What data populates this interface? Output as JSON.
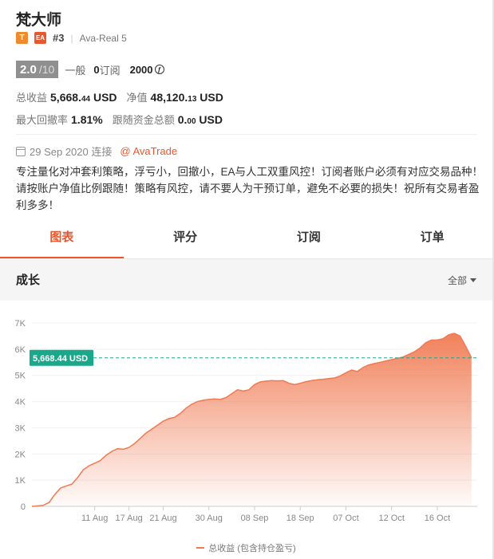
{
  "header": {
    "title": "梵大师",
    "badge_t": "T",
    "badge_ea": "EA",
    "rank": "#3",
    "account": "Ava-Real 5",
    "score": "2.0",
    "score_of": "/10",
    "level": "一般",
    "subs_count": "0",
    "subs_label": "订阅",
    "points": "2000"
  },
  "stats": {
    "total_profit_label": "总收益",
    "total_profit_main": "5,668.",
    "total_profit_dec": "44",
    "total_profit_unit": " USD",
    "equity_label": "净值",
    "equity_main": "48,120.",
    "equity_dec": "13",
    "equity_unit": " USD",
    "max_dd_label": "最大回撤率",
    "max_dd_value": "1.81%",
    "follow_label": "跟随资金总额",
    "follow_main": "0.",
    "follow_dec": "00",
    "follow_unit": " USD"
  },
  "meta": {
    "connected": "29 Sep 2020 连接",
    "broker": "@ AvaTrade"
  },
  "description": "专注量化对冲套利策略，浮亏小，回撤小，EA与人工双重风控！订阅者账户必须有对应交易品种！请按账户净值比例跟随！策略有风控，请不要人为干预订单，避免不必要的损失！祝所有交易者盈利多多！",
  "tabs": [
    {
      "label": "图表",
      "active": true
    },
    {
      "label": "评分",
      "active": false
    },
    {
      "label": "订阅",
      "active": false
    },
    {
      "label": "订单",
      "active": false
    }
  ],
  "panel": {
    "title": "成长",
    "filter": "全部"
  },
  "colors": {
    "accent": "#e8572e",
    "line": "#f07a52",
    "marker": "#1aa88a"
  },
  "chart_data": {
    "type": "area",
    "legend": "总收益 (包含持仓盈亏)",
    "current_label": "5,668.44 USD",
    "current_value": 5668.44,
    "ylim": [
      0,
      7000
    ],
    "yticks": [
      {
        "v": 0,
        "label": "0"
      },
      {
        "v": 1000,
        "label": "1K"
      },
      {
        "v": 2000,
        "label": "2K"
      },
      {
        "v": 3000,
        "label": "3K"
      },
      {
        "v": 4000,
        "label": "4K"
      },
      {
        "v": 5000,
        "label": "5K"
      },
      {
        "v": 6000,
        "label": "6K"
      },
      {
        "v": 7000,
        "label": "7K"
      }
    ],
    "xlim": [
      0,
      78
    ],
    "xticks": [
      {
        "v": 11,
        "label": "11 Aug"
      },
      {
        "v": 17,
        "label": "17 Aug"
      },
      {
        "v": 23,
        "label": "21 Aug"
      },
      {
        "v": 31,
        "label": "30 Aug"
      },
      {
        "v": 39,
        "label": "08 Sep"
      },
      {
        "v": 47,
        "label": "18 Sep"
      },
      {
        "v": 55,
        "label": "07 Oct"
      },
      {
        "v": 63,
        "label": "12 Oct"
      },
      {
        "v": 71,
        "label": "16 Oct"
      }
    ],
    "points": [
      [
        0,
        0
      ],
      [
        2,
        40
      ],
      [
        3,
        150
      ],
      [
        4,
        450
      ],
      [
        5,
        700
      ],
      [
        6,
        780
      ],
      [
        7,
        850
      ],
      [
        8,
        1100
      ],
      [
        9,
        1400
      ],
      [
        10,
        1550
      ],
      [
        11,
        1650
      ],
      [
        12,
        1750
      ],
      [
        13,
        1950
      ],
      [
        14,
        2100
      ],
      [
        15,
        2200
      ],
      [
        16,
        2180
      ],
      [
        17,
        2250
      ],
      [
        18,
        2400
      ],
      [
        19,
        2600
      ],
      [
        20,
        2800
      ],
      [
        21,
        2950
      ],
      [
        22,
        3100
      ],
      [
        23,
        3250
      ],
      [
        24,
        3350
      ],
      [
        25,
        3400
      ],
      [
        26,
        3550
      ],
      [
        27,
        3750
      ],
      [
        28,
        3900
      ],
      [
        29,
        4000
      ],
      [
        30,
        4050
      ],
      [
        31,
        4080
      ],
      [
        32,
        4100
      ],
      [
        33,
        4080
      ],
      [
        34,
        4150
      ],
      [
        35,
        4300
      ],
      [
        36,
        4450
      ],
      [
        37,
        4400
      ],
      [
        38,
        4450
      ],
      [
        39,
        4650
      ],
      [
        40,
        4750
      ],
      [
        41,
        4780
      ],
      [
        42,
        4800
      ],
      [
        43,
        4790
      ],
      [
        44,
        4800
      ],
      [
        45,
        4700
      ],
      [
        46,
        4650
      ],
      [
        47,
        4700
      ],
      [
        48,
        4760
      ],
      [
        49,
        4800
      ],
      [
        50,
        4830
      ],
      [
        51,
        4850
      ],
      [
        52,
        4880
      ],
      [
        53,
        4900
      ],
      [
        54,
        4980
      ],
      [
        55,
        5100
      ],
      [
        56,
        5200
      ],
      [
        57,
        5150
      ],
      [
        58,
        5300
      ],
      [
        59,
        5400
      ],
      [
        60,
        5450
      ],
      [
        61,
        5500
      ],
      [
        62,
        5550
      ],
      [
        63,
        5600
      ],
      [
        64,
        5650
      ],
      [
        65,
        5700
      ],
      [
        66,
        5800
      ],
      [
        67,
        5900
      ],
      [
        68,
        6050
      ],
      [
        69,
        6250
      ],
      [
        70,
        6350
      ],
      [
        71,
        6350
      ],
      [
        72,
        6400
      ],
      [
        73,
        6550
      ],
      [
        74,
        6600
      ],
      [
        75,
        6500
      ],
      [
        76,
        6100
      ],
      [
        77,
        5668
      ]
    ]
  }
}
